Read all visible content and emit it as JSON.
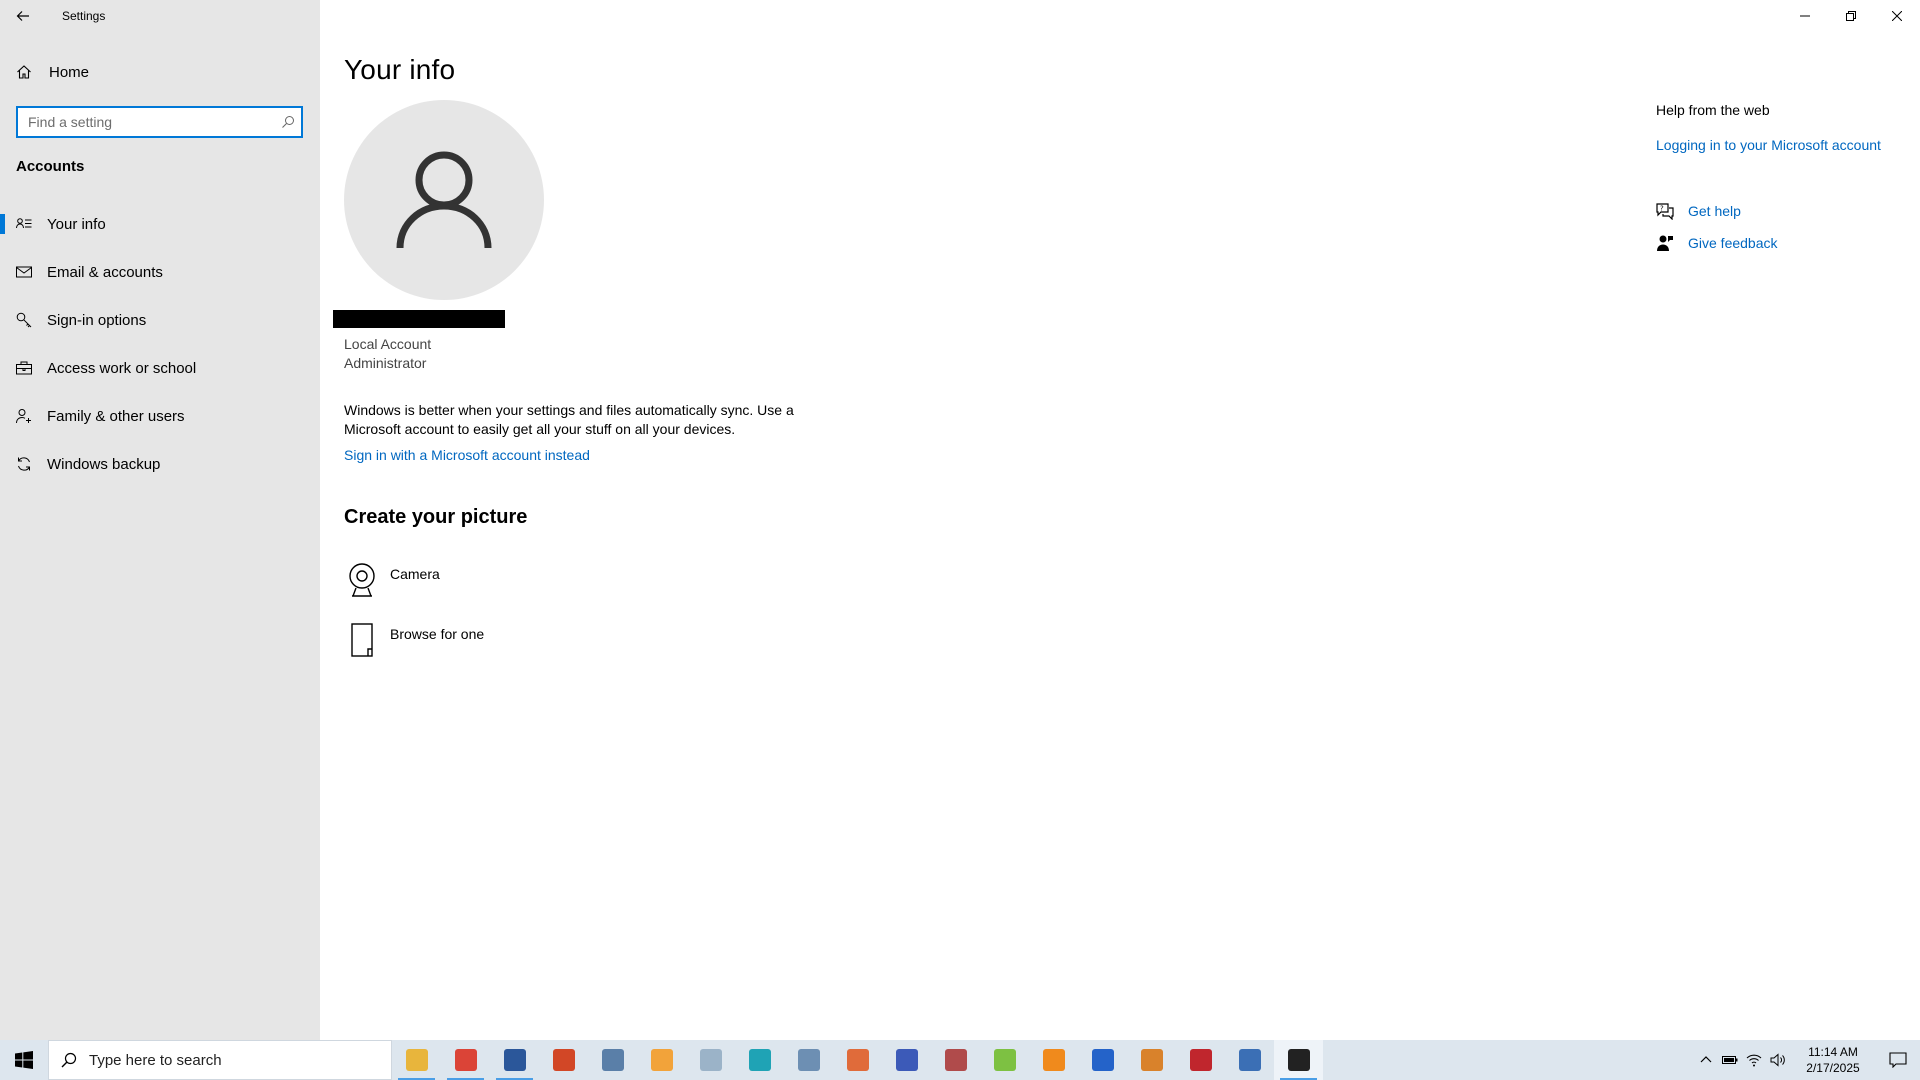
{
  "window": {
    "title": "Settings"
  },
  "sidebar": {
    "home_label": "Home",
    "search_placeholder": "Find a setting",
    "section": "Accounts",
    "items": [
      {
        "label": "Your info",
        "icon": "person-list-icon",
        "active": true
      },
      {
        "label": "Email & accounts",
        "icon": "mail-icon"
      },
      {
        "label": "Sign-in options",
        "icon": "key-icon"
      },
      {
        "label": "Access work or school",
        "icon": "briefcase-icon"
      },
      {
        "label": "Family & other users",
        "icon": "person-add-icon"
      },
      {
        "label": "Windows backup",
        "icon": "sync-icon"
      }
    ]
  },
  "main": {
    "title": "Your info",
    "account_type": "Local Account",
    "account_role": "Administrator",
    "sync_message": "Windows is better when your settings and files automatically sync. Use a Microsoft account to easily get all your stuff on all your devices.",
    "signin_link": "Sign in with a Microsoft account instead",
    "create_picture_heading": "Create your picture",
    "picture_options": [
      {
        "label": "Camera",
        "icon": "camera-icon"
      },
      {
        "label": "Browse for one",
        "icon": "browse-icon"
      }
    ]
  },
  "help": {
    "title": "Help from the web",
    "web_link": "Logging in to your Microsoft account",
    "get_help": "Get help",
    "give_feedback": "Give feedback"
  },
  "taskbar": {
    "search_placeholder": "Type here to search",
    "apps": [
      {
        "name": "file-explorer",
        "color": "#e8b53c",
        "running": true
      },
      {
        "name": "chrome",
        "color": "#db4437",
        "running": true
      },
      {
        "name": "word",
        "color": "#2b579a",
        "running": true
      },
      {
        "name": "powerpoint",
        "color": "#d24726"
      },
      {
        "name": "calculator",
        "color": "#5a7fa8"
      },
      {
        "name": "app-orange",
        "color": "#f2a33a"
      },
      {
        "name": "app-pencil",
        "color": "#9bb3c8"
      },
      {
        "name": "app-teal",
        "color": "#1fa3b5"
      },
      {
        "name": "app-dictionary",
        "color": "#6d8fb3"
      },
      {
        "name": "app-tools",
        "color": "#e06b3a"
      },
      {
        "name": "app-game",
        "color": "#3c5ab8"
      },
      {
        "name": "app-outlook",
        "color": "#b04b4b"
      },
      {
        "name": "app-green",
        "color": "#7dc142"
      },
      {
        "name": "vlc",
        "color": "#f08a1c"
      },
      {
        "name": "app-blue",
        "color": "#2463c9"
      },
      {
        "name": "app-search",
        "color": "#d9822b"
      },
      {
        "name": "app-pdf",
        "color": "#c0262d"
      },
      {
        "name": "app-pen",
        "color": "#3b6fb5"
      },
      {
        "name": "settings",
        "color": "#222222",
        "running": true,
        "active": true
      }
    ],
    "time": "11:14 AM",
    "date": "2/17/2025"
  },
  "colors": {
    "accent": "#0078d7",
    "link": "#0067c0",
    "sidebar_bg": "#e6e6e6",
    "taskbar_bg": "#dde6ee"
  }
}
